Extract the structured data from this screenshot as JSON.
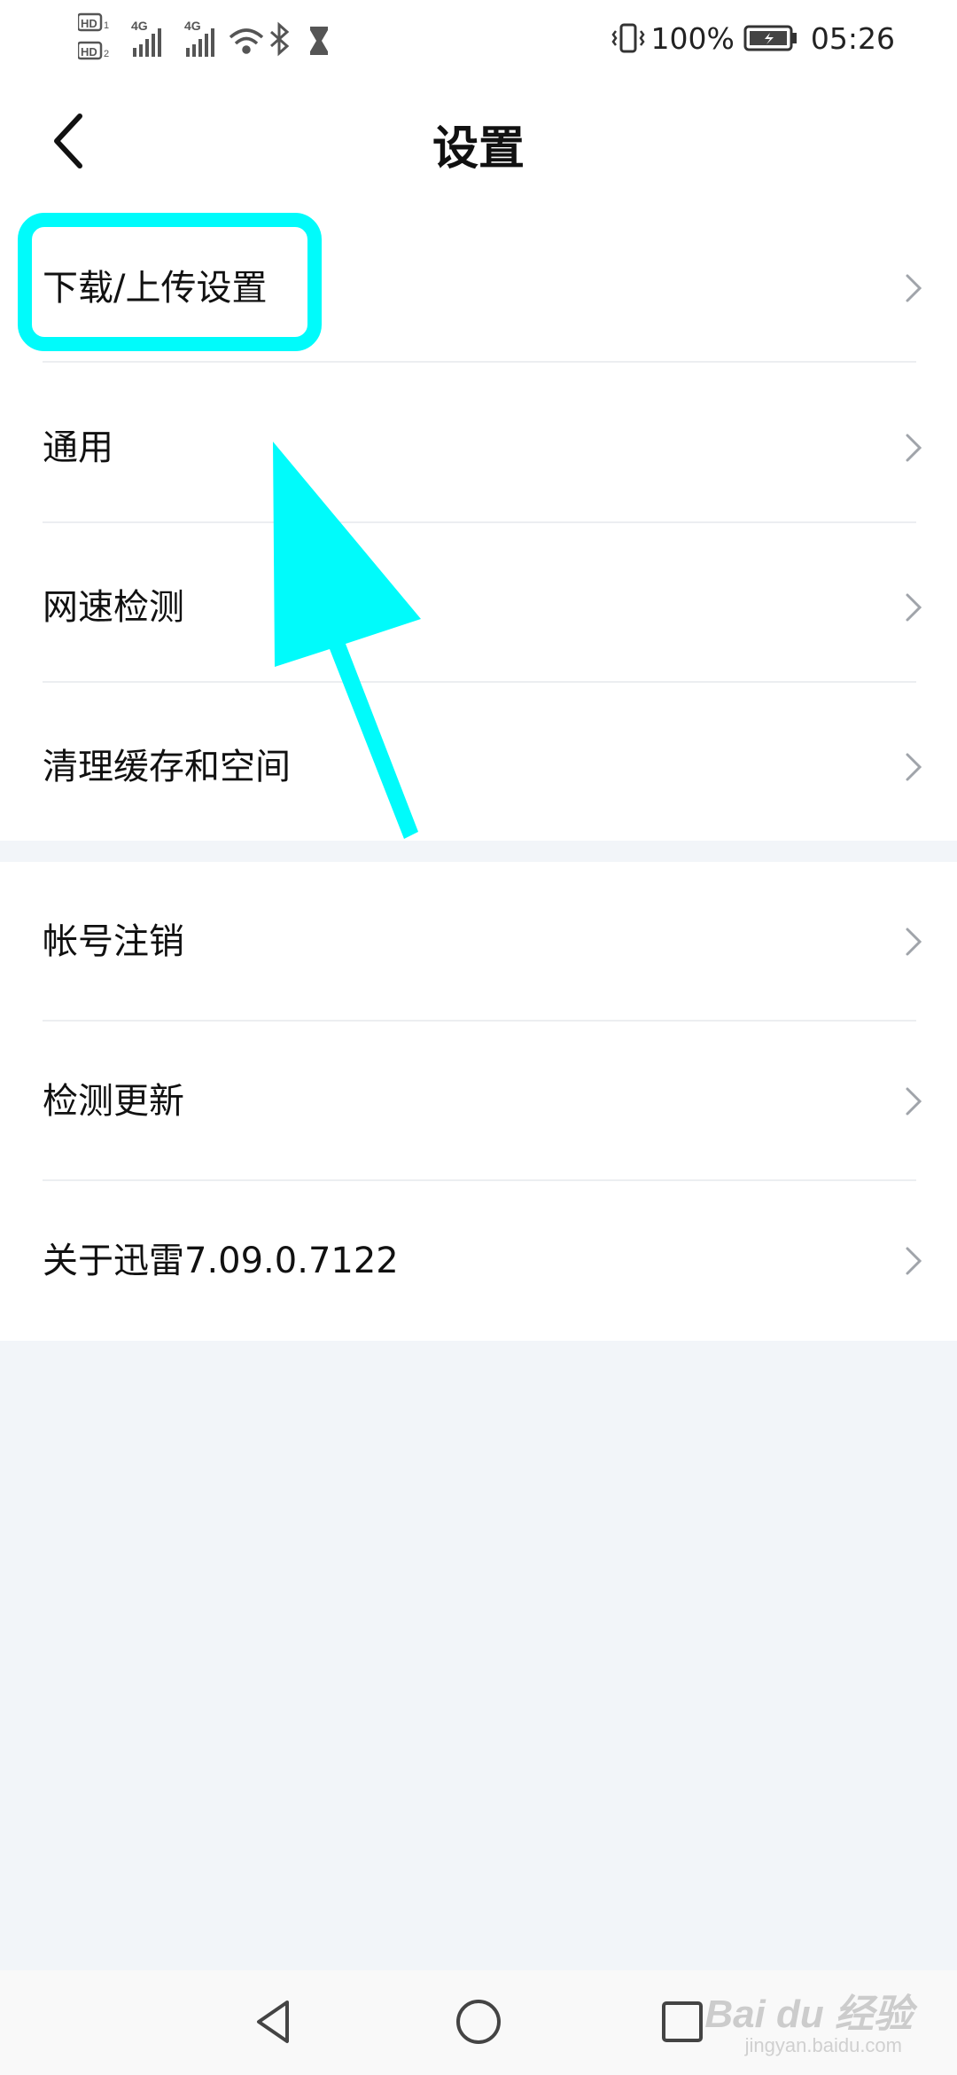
{
  "status_bar": {
    "battery_percent": "100%",
    "time": "05:26",
    "network_labels": [
      "HD",
      "HD",
      "4G",
      "4G"
    ]
  },
  "header": {
    "title": "设置"
  },
  "groups": [
    {
      "items": [
        {
          "label": "下载/上传设置"
        },
        {
          "label": "通用"
        },
        {
          "label": "网速检测"
        },
        {
          "label": "清理缓存和空间"
        }
      ]
    },
    {
      "items": [
        {
          "label": "帐号注销"
        },
        {
          "label": "检测更新"
        },
        {
          "label": "关于迅雷7.09.0.7122"
        }
      ]
    }
  ],
  "annotation": {
    "highlight_color": "#00fbfb",
    "target": "下载/上传设置"
  },
  "watermark": {
    "brand": "Bai du 经验",
    "domain": "jingyan.baidu.com"
  },
  "colors": {
    "page_background": "#f2f5f9",
    "card_background": "#ffffff",
    "text": "#111111",
    "chevron": "#a0a4aa",
    "annotation_cyan": "#00fbfb"
  }
}
